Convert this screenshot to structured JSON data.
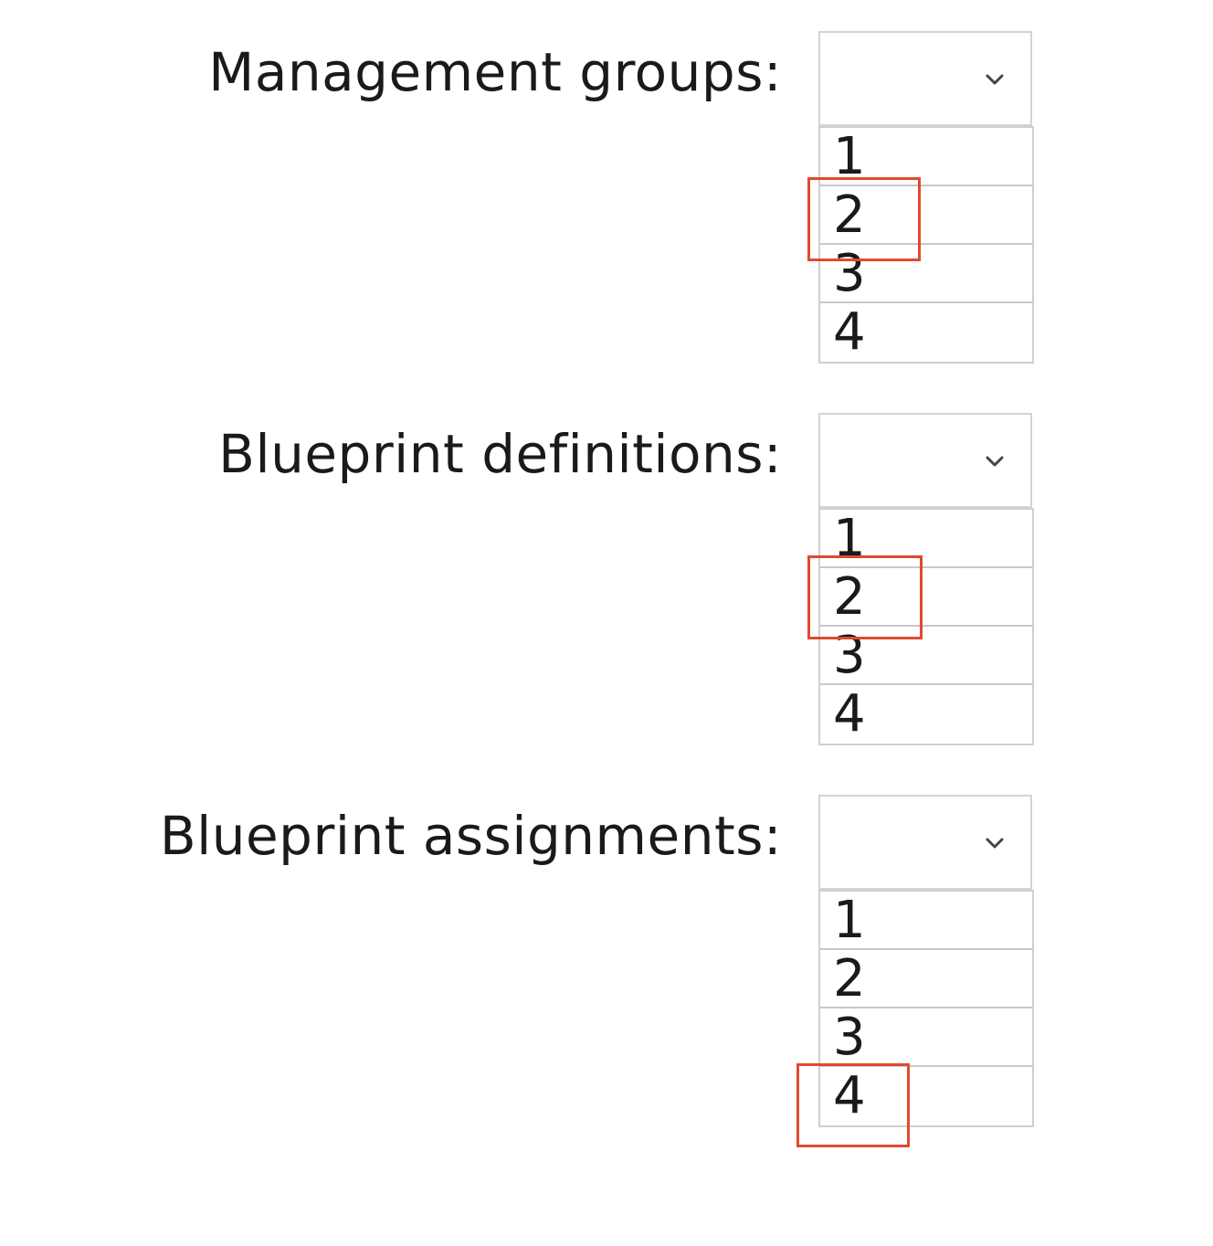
{
  "questions": [
    {
      "label": "Management groups:",
      "options": [
        "1",
        "2",
        "3",
        "4"
      ],
      "answer": "2"
    },
    {
      "label": "Blueprint definitions:",
      "options": [
        "1",
        "2",
        "3",
        "4"
      ],
      "answer": "2"
    },
    {
      "label": "Blueprint assignments:",
      "options": [
        "1",
        "2",
        "3",
        "4"
      ],
      "answer": "4"
    }
  ],
  "colors": {
    "highlight": "#e04a2f",
    "border": "#d4d4d4"
  },
  "icons": {
    "dropdown": "chevron-down-icon"
  }
}
